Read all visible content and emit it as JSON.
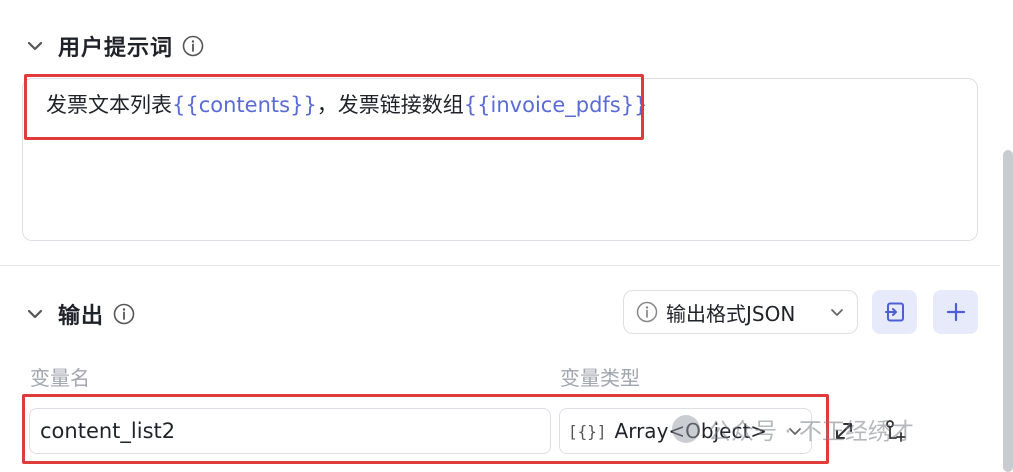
{
  "prompt_section": {
    "title": "用户提示词",
    "content_parts": [
      {
        "text": "发票文本列表",
        "kind": "text"
      },
      {
        "text": "{{contents}}",
        "kind": "var"
      },
      {
        "text": "，发票链接数组",
        "kind": "text"
      },
      {
        "text": "{{invoice_pdfs}}",
        "kind": "var"
      }
    ]
  },
  "output_section": {
    "title": "输出",
    "format_label": "输出格式JSON",
    "col_name_label": "变量名",
    "col_type_label": "变量类型",
    "variable_name": "content_list2",
    "variable_type": "Array<Object>",
    "type_glyph": "[{}]"
  },
  "watermark": "公众号 · 不正经绣才",
  "colors": {
    "accent": "#5a6bd6",
    "highlight_box": "#e03b3b",
    "button_bg": "#e7eafb"
  }
}
